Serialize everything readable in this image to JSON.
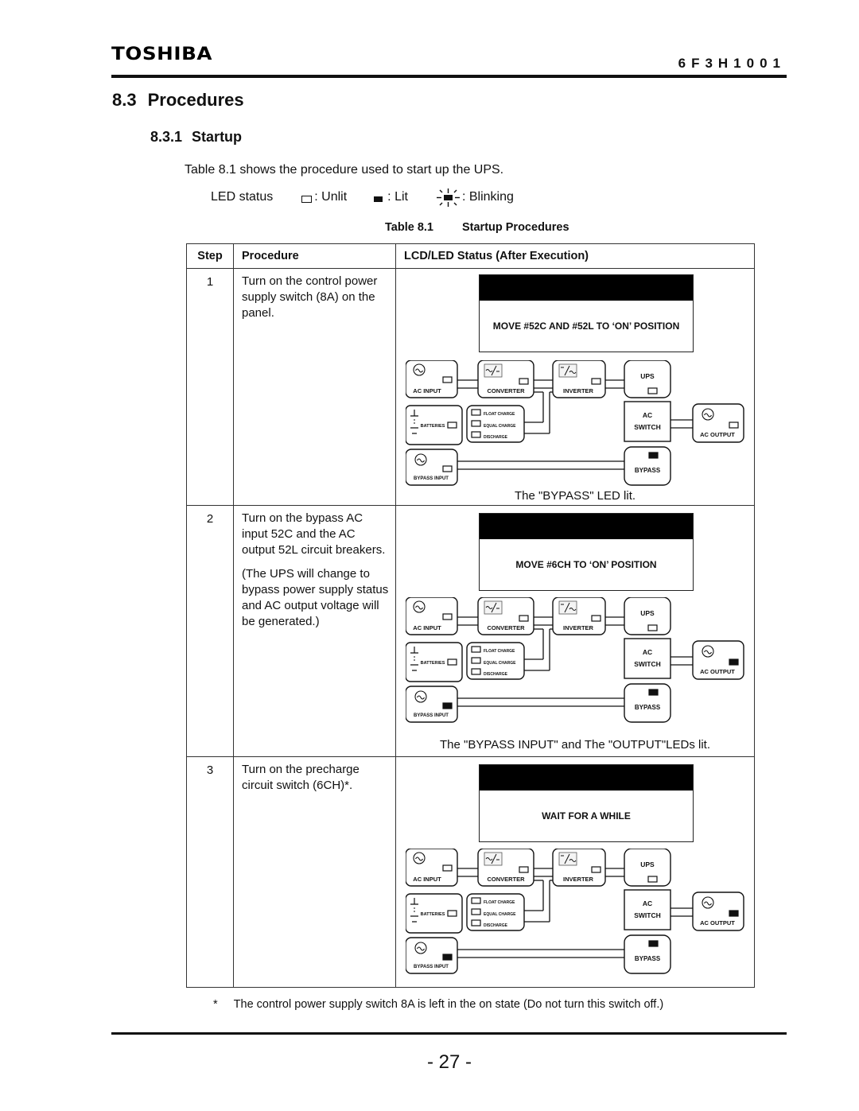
{
  "header": {
    "brand": "TOSHIBA",
    "doc_number": "6F3H1001"
  },
  "section": {
    "number": "8.3",
    "title": "Procedures"
  },
  "subsection": {
    "number": "8.3.1",
    "title": "Startup"
  },
  "intro": "Table 8.1 shows the procedure used to start up the UPS.",
  "legend": {
    "label": "LED status",
    "unlit": ": Unlit",
    "lit": ": Lit",
    "blinking": ": Blinking"
  },
  "table": {
    "caption_number": "Table 8.1",
    "caption_title": "Startup Procedures",
    "headers": {
      "step": "Step",
      "procedure": "Procedure",
      "status": "LCD/LED Status (After Execution)"
    },
    "rows": [
      {
        "step": "1",
        "procedure": [
          "Turn on the control power supply switch (8A) on the panel."
        ],
        "lcd_message": "MOVE #52C AND #52L TO ‘ON’ POSITION",
        "result": "The \"BYPASS\" LED lit.",
        "leds": {
          "ac_input": "unlit",
          "converter": "unlit",
          "inverter": "unlit",
          "ups": "unlit",
          "batteries": "unlit",
          "float_charge": "unlit",
          "equal_charge": "unlit",
          "discharge": "unlit",
          "ac_output": "unlit",
          "bypass_input": "unlit",
          "bypass": "lit"
        }
      },
      {
        "step": "2",
        "procedure": [
          "Turn on the bypass AC input 52C and the AC output 52L circuit breakers.",
          "(The UPS will change to bypass power supply status and AC output voltage will be generated.)"
        ],
        "lcd_message": "MOVE #6CH TO ‘ON’ POSITION",
        "result": "The \"BYPASS INPUT\" and The \"OUTPUT\"LEDs lit.",
        "leds": {
          "ac_input": "unlit",
          "converter": "unlit",
          "inverter": "unlit",
          "ups": "unlit",
          "batteries": "unlit",
          "float_charge": "unlit",
          "equal_charge": "unlit",
          "discharge": "unlit",
          "ac_output": "lit",
          "bypass_input": "lit",
          "bypass": "lit"
        }
      },
      {
        "step": "3",
        "procedure": [
          "Turn on the precharge circuit switch (6CH)*."
        ],
        "lcd_message": "WAIT FOR A WHILE",
        "result": "",
        "leds": {
          "ac_input": "unlit",
          "converter": "unlit",
          "inverter": "unlit",
          "ups": "unlit",
          "batteries": "unlit",
          "float_charge": "unlit",
          "equal_charge": "unlit",
          "discharge": "unlit",
          "ac_output": "lit",
          "bypass_input": "lit",
          "bypass": "lit"
        }
      }
    ]
  },
  "diagram_labels": {
    "ac_input": "AC INPUT",
    "converter": "CONVERTER",
    "inverter": "INVERTER",
    "ups": "UPS",
    "batteries": "BATTERIES",
    "float_charge": "FLOAT CHARGE",
    "equal_charge": "EQUAL CHARGE",
    "discharge": "DISCHARGE",
    "ac_switch_1": "AC",
    "ac_switch_2": "SWITCH",
    "ac_output": "AC OUTPUT",
    "bypass_input": "BYPASS INPUT",
    "bypass": "BYPASS"
  },
  "footnote": {
    "marker": "*",
    "text": "The control power supply switch 8A is left in the on state (Do not turn this switch off.)"
  },
  "page_number": "- 27 -"
}
